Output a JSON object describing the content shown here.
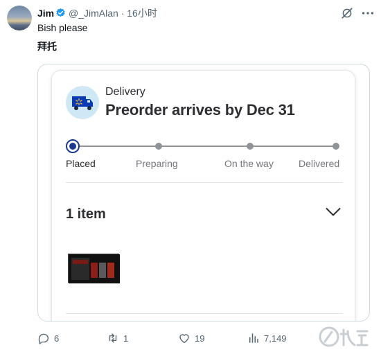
{
  "tweet": {
    "author_name": "Jim",
    "handle": "@_JimAlan",
    "separator": "·",
    "time": "16小时",
    "text_line1": "Bish please",
    "text_line2": "拜托"
  },
  "card": {
    "delivery_label": "Delivery",
    "headline": "Preorder arrives by Dec 31",
    "steps": [
      "Placed",
      "Preparing",
      "On the way",
      "Delivered"
    ],
    "current_step": 0,
    "items_count": "1 item"
  },
  "actions": {
    "replies": "6",
    "retweets": "1",
    "likes": "19",
    "views": "7,149"
  },
  "colors": {
    "verified": "#1d9bf0",
    "truck": "#0a3bb4",
    "accent": "#1a3a8f",
    "muted": "#536471"
  },
  "icons": [
    "verified-icon",
    "grok-icon",
    "more-icon",
    "truck-icon",
    "chevron-down-icon",
    "reply-icon",
    "retweet-icon",
    "like-icon",
    "views-icon"
  ]
}
